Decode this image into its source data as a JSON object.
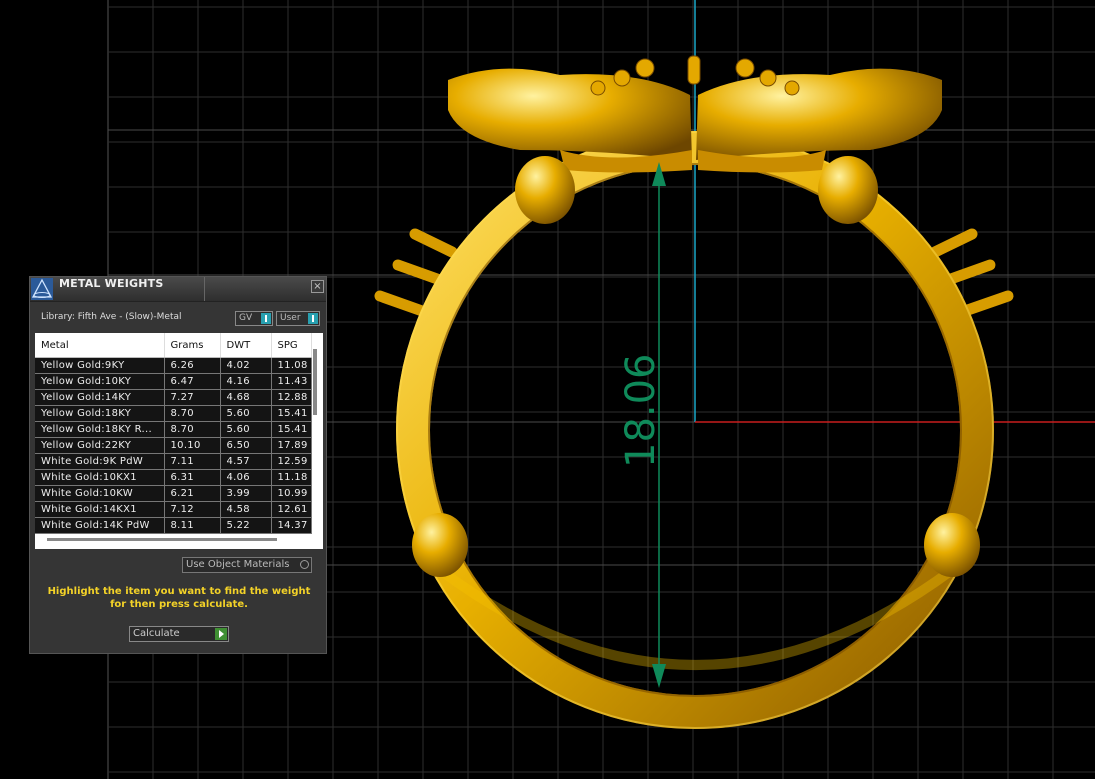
{
  "panel": {
    "title": "METAL WEIGHTS",
    "close_glyph": "×",
    "library": "Library: Fifth Ave - (Slow)-Metal",
    "toggles": {
      "gv": "GV",
      "user": "User"
    },
    "columns": [
      "Metal",
      "Grams",
      "DWT",
      "SPG"
    ],
    "rows": [
      [
        "Yellow Gold:9KY",
        "6.26",
        "4.02",
        "11.08"
      ],
      [
        "Yellow Gold:10KY",
        "6.47",
        "4.16",
        "11.43"
      ],
      [
        "Yellow Gold:14KY",
        "7.27",
        "4.68",
        "12.88"
      ],
      [
        "Yellow Gold:18KY",
        "8.70",
        "5.60",
        "15.41"
      ],
      [
        "Yellow Gold:18KY R...",
        "8.70",
        "5.60",
        "15.41"
      ],
      [
        "Yellow Gold:22KY",
        "10.10",
        "6.50",
        "17.89"
      ],
      [
        "White Gold:9K PdW",
        "7.11",
        "4.57",
        "12.59"
      ],
      [
        "White Gold:10KX1",
        "6.31",
        "4.06",
        "11.18"
      ],
      [
        "White Gold:10KW",
        "6.21",
        "3.99",
        "10.99"
      ],
      [
        "White Gold:14KX1",
        "7.12",
        "4.58",
        "12.61"
      ],
      [
        "White Gold:14K PdW",
        "8.11",
        "5.22",
        "14.37"
      ]
    ],
    "use_object_materials": "Use Object Materials",
    "hint": "Highlight the item you want to find the weight for then press calculate.",
    "calculate": "Calculate"
  },
  "viewport": {
    "dimension_value": "18.06",
    "colors": {
      "grid": "#3a3a3a",
      "axis_y": "#1aa7c8",
      "axis_x": "#c81e1e",
      "dimension": "#0f8a5a",
      "gold": "#e8b000",
      "highlight_text": "#f3d228"
    }
  }
}
